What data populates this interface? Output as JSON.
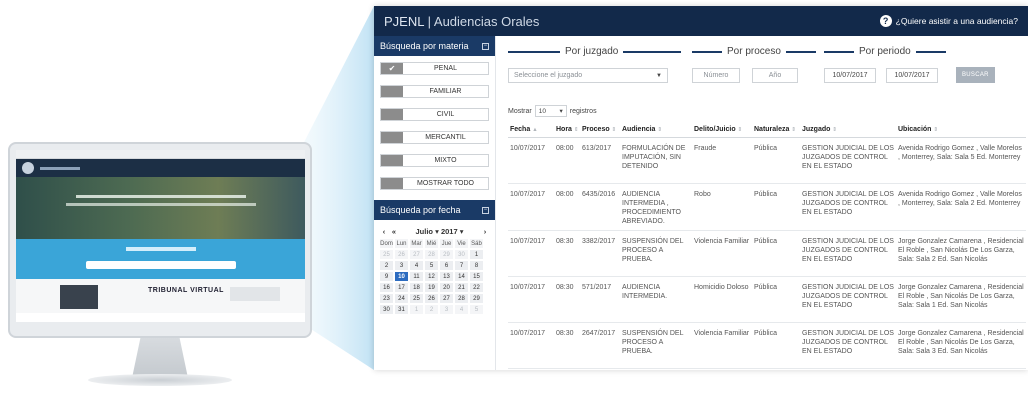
{
  "illustration": {
    "tribunal_text": "TRIBUNAL VIRTUAL"
  },
  "topbar": {
    "brand": "PJENL",
    "separator": "|",
    "title": "Audiencias Orales",
    "help_icon": "question-circle-icon",
    "help_text": "¿Quiere asistir a una audiencia?"
  },
  "sidebar": {
    "materia_header": "Búsqueda por materia",
    "materias": [
      {
        "label": "PENAL",
        "checked": true
      },
      {
        "label": "FAMILIAR",
        "checked": false
      },
      {
        "label": "CIVIL",
        "checked": false
      },
      {
        "label": "MERCANTIL",
        "checked": false
      },
      {
        "label": "MIXTO",
        "checked": false
      }
    ],
    "mostrar_todo": "MOSTRAR TODO",
    "fecha_header": "Búsqueda por fecha",
    "calendar": {
      "prev": "‹",
      "prev2": "«",
      "month": "Julio",
      "year": "2017",
      "next": "›",
      "days_of_week": [
        "Dom",
        "Lun",
        "Mar",
        "Mié",
        "Jue",
        "Vie",
        "Sáb"
      ],
      "weeks": [
        [
          "25",
          "26",
          "27",
          "28",
          "29",
          "30",
          "1"
        ],
        [
          "2",
          "3",
          "4",
          "5",
          "6",
          "7",
          "8"
        ],
        [
          "9",
          "10",
          "11",
          "12",
          "13",
          "14",
          "15"
        ],
        [
          "16",
          "17",
          "18",
          "19",
          "20",
          "21",
          "22"
        ],
        [
          "23",
          "24",
          "25",
          "26",
          "27",
          "28",
          "29"
        ],
        [
          "30",
          "31",
          "1",
          "2",
          "3",
          "4",
          "5"
        ]
      ],
      "selected_day": "10"
    }
  },
  "filters": {
    "por_juzgado": "Por juzgado",
    "por_proceso": "Por proceso",
    "por_periodo": "Por periodo",
    "juzgado_placeholder": "Seleccione el juzgado",
    "numero_placeholder": "Número",
    "anio_placeholder": "Año",
    "fecha_inicio": "10/07/2017",
    "fecha_fin": "10/07/2017",
    "buscar": "BUSCAR"
  },
  "table": {
    "mostrar_label": "Mostrar",
    "page_size": "10",
    "registros_label": "registros",
    "columns": [
      "Fecha",
      "Hora",
      "Proceso",
      "Audiencia",
      "Delito/Juicio",
      "Naturaleza",
      "Juzgado",
      "Ubicación"
    ],
    "rows": [
      [
        "10/07/2017",
        "08:00",
        "613/2017",
        "FORMULACIÓN DE IMPUTACIÓN, SIN DETENIDO",
        "Fraude",
        "Pública",
        "GESTION JUDICIAL DE LOS JUZGADOS DE CONTROL EN EL ESTADO",
        "Avenida Rodrigo Gomez , Valle Morelos , Monterrey, Sala: Sala 5 Ed. Monterrey"
      ],
      [
        "10/07/2017",
        "08:00",
        "6435/2016",
        "AUDIENCIA INTERMEDIA , PROCEDIMIENTO ABREVIADO.",
        "Robo",
        "Pública",
        "GESTION JUDICIAL DE LOS JUZGADOS DE CONTROL EN EL ESTADO",
        "Avenida Rodrigo Gomez , Valle Morelos , Monterrey, Sala: Sala 2 Ed. Monterrey"
      ],
      [
        "10/07/2017",
        "08:30",
        "3382/2017",
        "SUSPENSIÓN DEL PROCESO A PRUEBA.",
        "Violencia Familiar",
        "Pública",
        "GESTION JUDICIAL DE LOS JUZGADOS DE CONTROL EN EL ESTADO",
        "Jorge Gonzalez Camarena , Residencial El Roble , San Nicolás De Los Garza, Sala: Sala 2 Ed. San Nicolás"
      ],
      [
        "10/07/2017",
        "08:30",
        "571/2017",
        "AUDIENCIA INTERMEDIA.",
        "Homicidio Doloso",
        "Pública",
        "GESTION JUDICIAL DE LOS JUZGADOS DE CONTROL EN EL ESTADO",
        "Jorge Gonzalez Camarena , Residencial El Roble , San Nicolás De Los Garza, Sala: Sala 1 Ed. San Nicolás"
      ],
      [
        "10/07/2017",
        "08:30",
        "2647/2017",
        "SUSPENSIÓN DEL PROCESO A PRUEBA.",
        "Violencia Familiar",
        "Pública",
        "GESTION JUDICIAL DE LOS JUZGADOS DE CONTROL EN EL ESTADO",
        "Jorge Gonzalez Camarena , Residencial El Roble , San Nicolás De Los Garza, Sala: Sala 3 Ed. San Nicolás"
      ]
    ]
  },
  "colors": {
    "navy": "#12294a",
    "sidebar_header": "#1a3a66",
    "selected_day": "#2d6cc0",
    "monitor_blue": "#3aa5d8"
  }
}
